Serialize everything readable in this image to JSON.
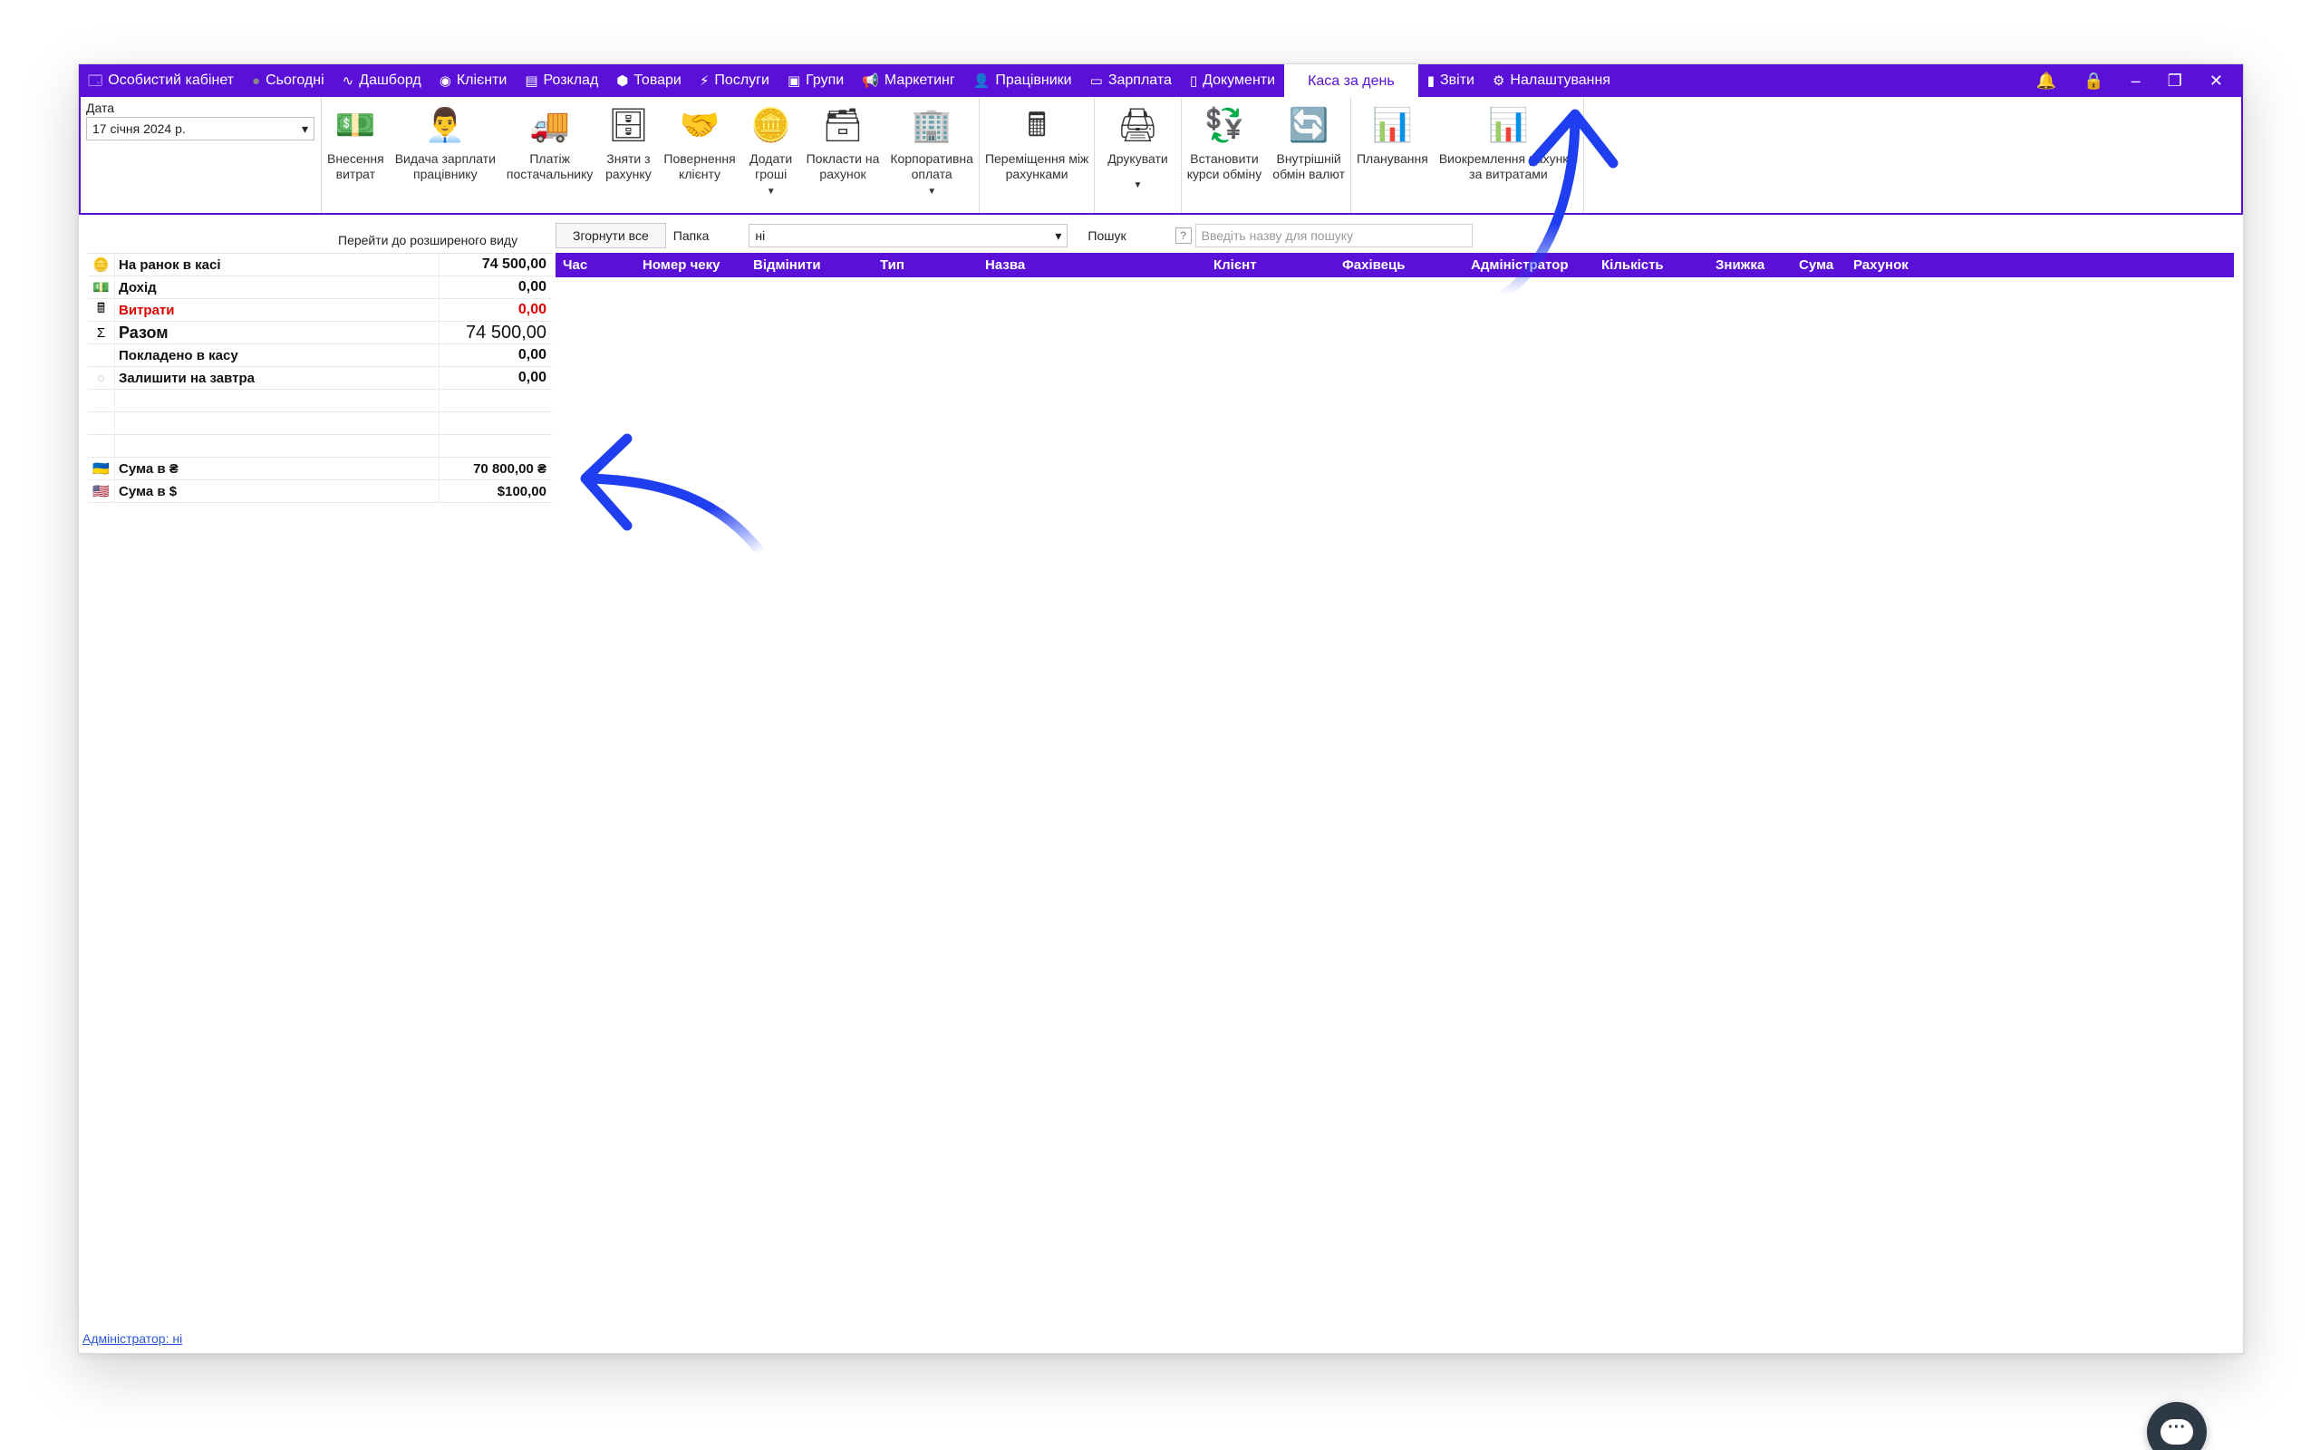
{
  "nav": {
    "items": [
      {
        "label": "Особистий кабінет",
        "icon": "🗔"
      },
      {
        "label": "Сьогодні",
        "icon": "●"
      },
      {
        "label": "Дашборд",
        "icon": "∿"
      },
      {
        "label": "Клієнти",
        "icon": "◉"
      },
      {
        "label": "Розклад",
        "icon": "▤"
      },
      {
        "label": "Товари",
        "icon": "⬢"
      },
      {
        "label": "Послуги",
        "icon": "⚡"
      },
      {
        "label": "Групи",
        "icon": "▣"
      },
      {
        "label": "Маркетинг",
        "icon": "📢"
      },
      {
        "label": "Працівники",
        "icon": "👤"
      },
      {
        "label": "Зарплата",
        "icon": "▭"
      },
      {
        "label": "Документи",
        "icon": "▯"
      },
      {
        "label": "Каса за день",
        "icon": ""
      },
      {
        "label": "Звіти",
        "icon": "▮"
      },
      {
        "label": "Налаштування",
        "icon": "⚙"
      }
    ],
    "active": "Каса за день"
  },
  "ribbon": {
    "date_label": "Дата",
    "date_value": "17 січня 2024 р.",
    "buttons": [
      {
        "label1": "Внесення",
        "label2": "витрат",
        "icon": "💵"
      },
      {
        "label1": "Видача зарплати",
        "label2": "працівнику",
        "icon": "👨‍💼"
      },
      {
        "label1": "Платіж",
        "label2": "постачальнику",
        "icon": "🚚"
      },
      {
        "label1": "Зняти з",
        "label2": "рахунку",
        "icon": "🗄"
      },
      {
        "label1": "Повернення",
        "label2": "клієнту",
        "icon": "🤝"
      },
      {
        "label1": "Додати",
        "label2": "гроші",
        "icon": "🪙"
      },
      {
        "label1": "Покласти на",
        "label2": "рахунок",
        "icon": "🗃"
      },
      {
        "label1": "Корпоративна",
        "label2": "оплата",
        "icon": "🏢"
      },
      {
        "label1": "Переміщення між",
        "label2": "рахунками",
        "icon": "🖩"
      },
      {
        "label1": "Друкувати",
        "label2": "",
        "icon": "🖨"
      },
      {
        "label1": "Встановити",
        "label2": "курси обміну",
        "icon": "💱"
      },
      {
        "label1": "Внутрішній",
        "label2": "обмін валют",
        "icon": "🔄"
      },
      {
        "label1": "Планування",
        "label2": "",
        "icon": "📊"
      },
      {
        "label1": "Виокремлення рахунків",
        "label2": "за витратами",
        "icon": "📊"
      }
    ]
  },
  "content": {
    "advanced_view_link": "Перейти до розширеного виду",
    "collapse_button": "Згорнути все",
    "folder_label": "Папка",
    "folder_value": "ні",
    "search_label": "Пошук",
    "search_placeholder": "Введіть назву для пошуку",
    "admin_link": "Адміністратор: ні"
  },
  "summary": [
    {
      "label": "На ранок в касі",
      "value": "74 500,00",
      "icon": "🪙"
    },
    {
      "label": "Дохід",
      "value": "0,00",
      "icon": "💵"
    },
    {
      "label": "Витрати",
      "value": "0,00",
      "icon": "🖩"
    },
    {
      "label": "Разом",
      "value": "74 500,00",
      "icon": "Σ"
    },
    {
      "label": "Покладено в касу",
      "value": "0,00",
      "icon": ""
    },
    {
      "label": "Залишити на завтра",
      "value": "0,00",
      "icon": "○"
    },
    {
      "label": "Сума в ₴",
      "value": "70 800,00 ₴",
      "icon": "🇺🇦"
    },
    {
      "label": "Сума в $",
      "value": "$100,00",
      "icon": "🇺🇸"
    }
  ],
  "grid": {
    "columns": [
      "Час",
      "Номер чеку",
      "Відмінити",
      "Тип",
      "Назва",
      "Клієнт",
      "Фахівець",
      "Адміністратор",
      "Кількість",
      "Знижка",
      "Сума",
      "Рахунок"
    ]
  },
  "colors": {
    "accent": "#5b10d8",
    "negative": "#e00000",
    "link": "#2b55d8",
    "arrow": "#1f3ef0"
  }
}
